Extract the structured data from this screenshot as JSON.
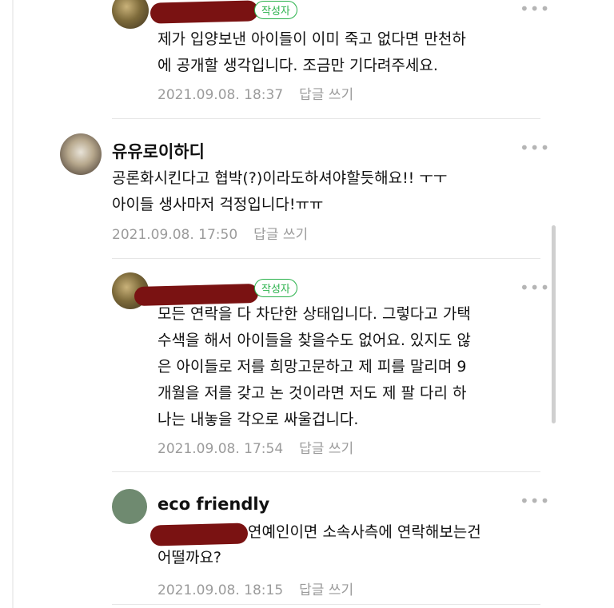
{
  "comments": [
    {
      "author": "",
      "author_badge": "작성자",
      "text_lines": [
        "제가 입양보낸 아이들이 이미 죽고 없다면 만천하",
        "에 공개할 생각입니다. 조금만 기다려주세요."
      ],
      "timestamp": "2021.09.08. 18:37",
      "reply_label": "답글 쓰기"
    },
    {
      "author": "유유로이하디",
      "text_lines": [
        "공론화시킨다고  협박(?)이라도하셔야할듯해요!!  ㅜㅜ",
        "아이들  생사마저  걱정입니다!ㅠㅠ"
      ],
      "timestamp": "2021.09.08. 17:50",
      "reply_label": "답글 쓰기"
    },
    {
      "author": "",
      "author_badge": "작성자",
      "text_lines": [
        "모든 연락을 다 차단한 상태입니다. 그렇다고 가택",
        "수색을 해서 아이들을 찾을수도 없어요. 있지도 않",
        "은 아이들로 저를 희망고문하고 제 피를 말리며 9",
        "개월을 저를 갖고 논 것이라면 저도 제 팔 다리 하",
        "나는 내놓을 각오로 싸울겁니다."
      ],
      "timestamp": "2021.09.08. 17:54",
      "reply_label": "답글 쓰기"
    },
    {
      "author": "eco friendly",
      "text_lines": [
        "연예인이면 소속사측에 연락해보는건",
        "어떨까요?"
      ],
      "timestamp": "2021.09.08. 18:15",
      "reply_label": "답글 쓰기"
    }
  ],
  "more_glyph": "•••",
  "icons": {
    "more": "more-options-icon"
  },
  "colors": {
    "badge_green": "#2bb24c",
    "meta_gray": "#9b9b9b",
    "redaction": "#7a1212"
  }
}
